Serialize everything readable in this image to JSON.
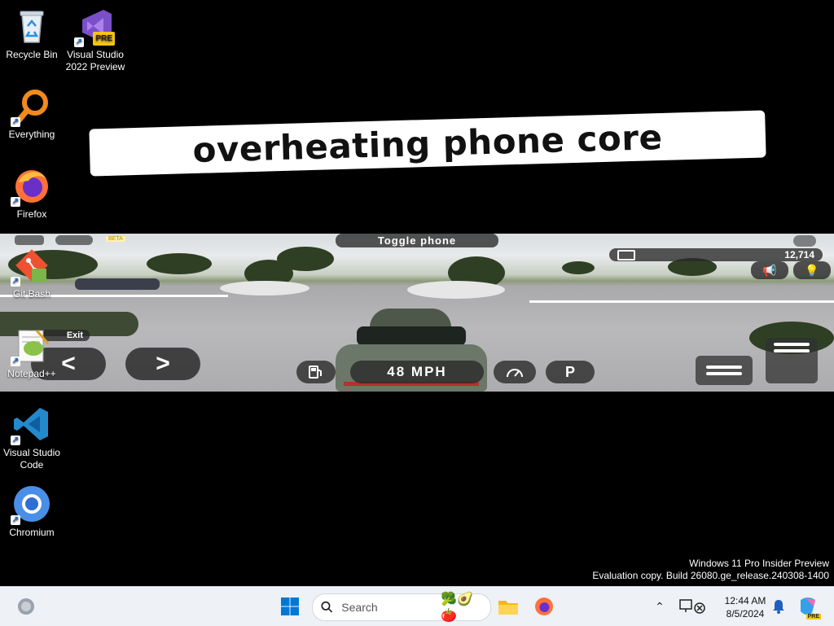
{
  "desktop": {
    "icons": [
      {
        "label": "Recycle Bin",
        "icon": "recycle-bin-icon"
      },
      {
        "label": "Visual Studio 2022 Preview",
        "icon": "visual-studio-preview-icon",
        "badge": "PRE"
      },
      {
        "label": "Everything",
        "icon": "everything-search-icon"
      },
      {
        "label": "Firefox",
        "icon": "firefox-icon"
      },
      {
        "label": "Git Bash",
        "icon": "git-bash-icon"
      },
      {
        "label": "Notepad++",
        "icon": "notepad-plus-plus-icon"
      },
      {
        "label": "Visual Studio Code",
        "icon": "vscode-icon"
      },
      {
        "label": "Chromium",
        "icon": "chromium-icon"
      }
    ]
  },
  "caption": "overheating phone core",
  "game": {
    "toggle_phone": "Toggle phone",
    "beta_badge": "BETA",
    "money": "12,714",
    "exit_label": "Exit",
    "speed": "48 MPH",
    "gear": "P",
    "left_arrow": "<",
    "right_arrow": ">"
  },
  "watermark": {
    "line1": "Windows 11 Pro Insider Preview",
    "line2": "Evaluation copy. Build 26080.ge_release.240308-1400"
  },
  "taskbar": {
    "search_placeholder": "Search",
    "time": "12:44 AM",
    "date": "8/5/2024",
    "copilot_badge": "PRE"
  },
  "colors": {
    "desktop_bg": "#000000",
    "taskbar_bg": "#eef1f6",
    "windows_blue": "#0078d4",
    "firefox_orange": "#ff7139",
    "vscode_blue": "#2489ca"
  }
}
